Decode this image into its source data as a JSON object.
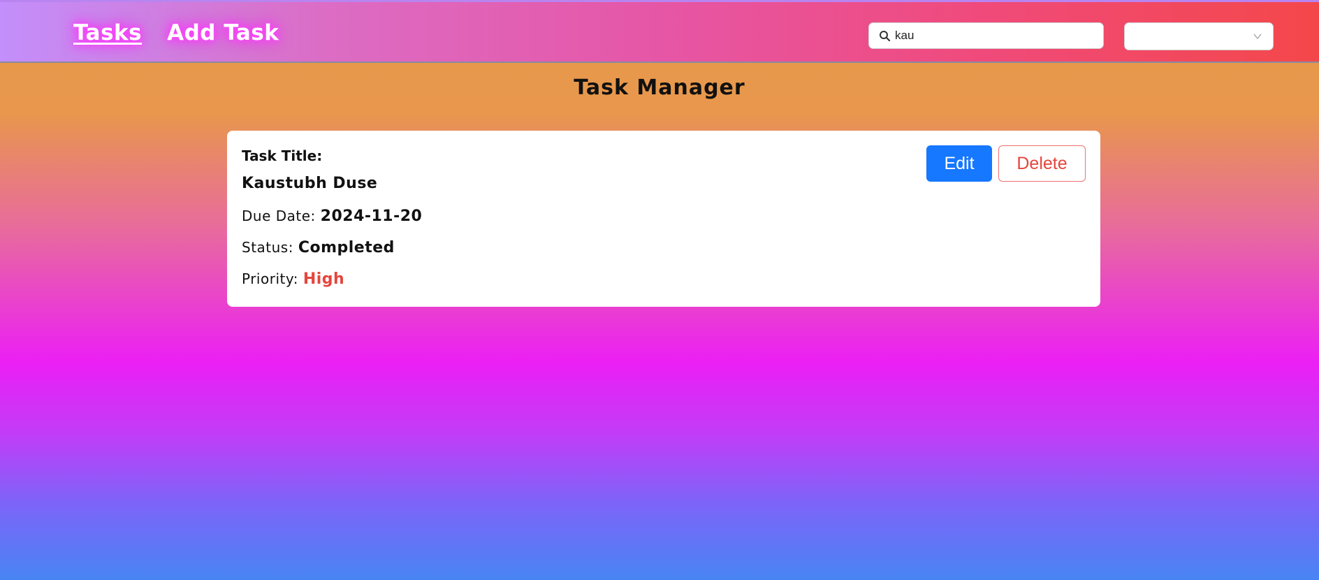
{
  "nav": {
    "links": [
      {
        "label": "Tasks"
      },
      {
        "label": "Add Task"
      }
    ],
    "search": {
      "value": "kau",
      "placeholder": ""
    },
    "filter_select": {
      "selected": ""
    }
  },
  "main": {
    "title": "Task Manager",
    "task": {
      "title_label": "Task Title:",
      "title_value": "Kaustubh Duse",
      "due_label": "Due Date:",
      "due_value": "2024-11-20",
      "status_label": "Status:",
      "status_value": "Completed",
      "priority_label": "Priority:",
      "priority_value": "High",
      "edit_label": "Edit",
      "delete_label": "Delete"
    }
  },
  "colors": {
    "primary": "#1677ff",
    "danger": "#e5453c",
    "nav_glow": "#ff33ff"
  },
  "icons": {
    "search": "search-icon",
    "dropdown": "chevron-down-icon"
  }
}
